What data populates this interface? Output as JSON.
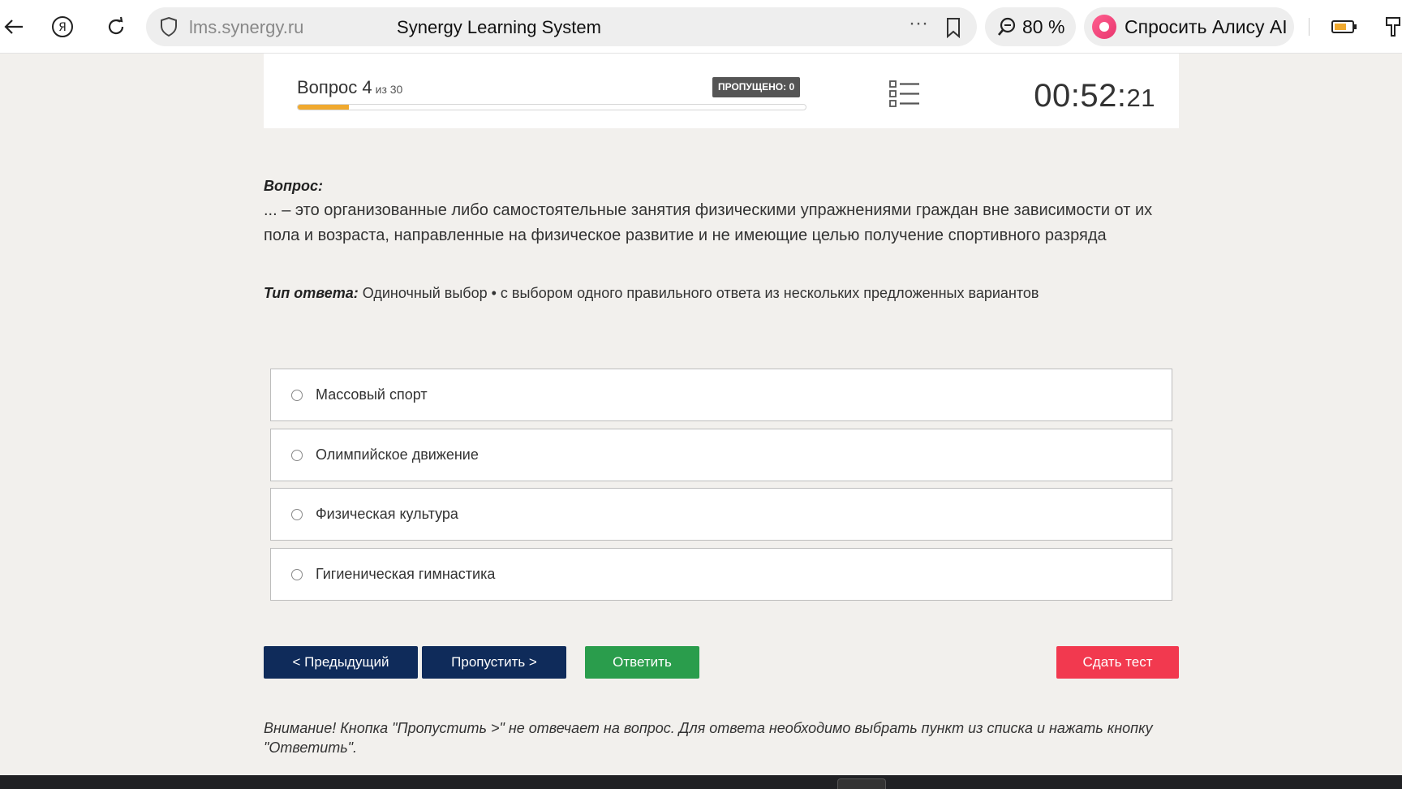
{
  "browser": {
    "url": "lms.synergy.ru",
    "site_title": "Synergy Learning System",
    "zoom": "80 %",
    "alice_label": "Спросить Алису AI",
    "more_label": "···"
  },
  "quiz": {
    "question_label": "Вопрос 4",
    "of_label": "из 30",
    "current": 4,
    "total": 30,
    "progress_fraction": 0.1,
    "skipped_label": "ПРОПУЩЕНО: 0",
    "timer_main": "00:52:",
    "timer_seconds": "21"
  },
  "question": {
    "label": "Вопрос:",
    "text": "... – это организованные либо самостоятельные занятия физическими упражнениями граждан вне зависимости от их пола и возраста, направленные на физическое развитие и не имеющие целью получение спортивного разряда",
    "type_label": "Тип ответа:",
    "type_value": " Одиночный выбор • с выбором одного правильного ответа из нескольких предложенных вариантов"
  },
  "options": [
    "Массовый спорт",
    "Олимпийское движение",
    "Физическая культура",
    "Гигиеническая гимнастика"
  ],
  "buttons": {
    "prev": "< Предыдущий",
    "skip": "Пропустить >",
    "answer": "Ответить",
    "submit": "Сдать тест"
  },
  "note": "Внимание! Кнопка \"Пропустить >\" не отвечает на вопрос. Для ответа необходимо выбрать пункт из списка и нажать кнопку \"Ответить\".",
  "colors": {
    "nav_button": "#0f2b5a",
    "answer_button": "#2a9d4c",
    "submit_button": "#f2394f",
    "progress": "#f0a92e"
  }
}
